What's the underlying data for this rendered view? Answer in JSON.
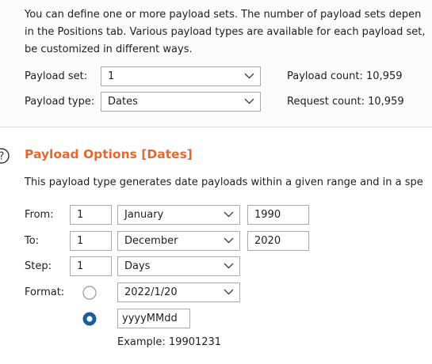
{
  "description": {
    "line1": "You can define one or more payload sets. The number of payload sets depen",
    "line2": "in the Positions tab. Various payload types are available for each payload set,",
    "line3": "be customized in different ways."
  },
  "payload_set": {
    "label": "Payload set:",
    "value": "1"
  },
  "payload_type": {
    "label": "Payload type:",
    "value": "Dates"
  },
  "counts": {
    "payload_count": "Payload count: 10,959",
    "request_count": "Request count: 10,959"
  },
  "options": {
    "title": "Payload Options [Dates]",
    "description": "This payload type generates date payloads within a given range and in a spe",
    "from": {
      "label": "From:",
      "day": "1",
      "month": "January",
      "year": "1990"
    },
    "to": {
      "label": "To:",
      "day": "1",
      "month": "December",
      "year": "2020"
    },
    "step": {
      "label": "Step:",
      "value": "1",
      "unit": "Days"
    },
    "format": {
      "label": "Format:",
      "preset_value": "2022/1/20",
      "custom_value": "yyyyMMdd",
      "selected": "custom",
      "example": "Example: 19901231"
    }
  },
  "colors": {
    "accent": "#e8672f",
    "radio_selected": "#1a5e9a",
    "border": "#a9a9a9"
  }
}
